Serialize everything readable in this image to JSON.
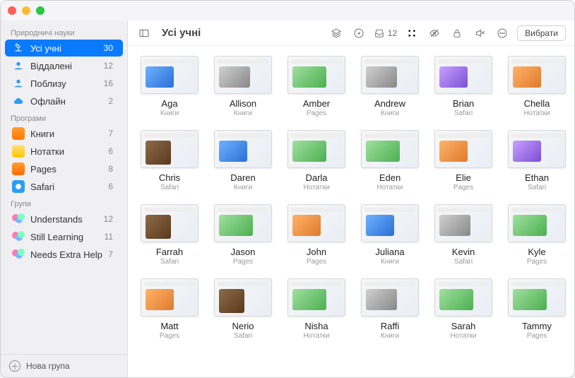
{
  "window": {
    "title": "Усі учні"
  },
  "toolbar": {
    "inbox_count": "12",
    "select_label": "Вибрати"
  },
  "sidebar": {
    "sections": [
      {
        "title": "Природничі науки",
        "items": [
          {
            "label": "Усі учні",
            "count": "30",
            "icon": "microscope",
            "active": true
          },
          {
            "label": "Віддалені",
            "count": "12",
            "icon": "person-blue"
          },
          {
            "label": "Поблизу",
            "count": "16",
            "icon": "person-blue"
          },
          {
            "label": "Офлайн",
            "count": "2",
            "icon": "cloud"
          }
        ]
      },
      {
        "title": "Програми",
        "items": [
          {
            "label": "Книги",
            "count": "7",
            "icon": "books"
          },
          {
            "label": "Нотатки",
            "count": "6",
            "icon": "notes"
          },
          {
            "label": "Pages",
            "count": "8",
            "icon": "pages"
          },
          {
            "label": "Safari",
            "count": "6",
            "icon": "safari"
          }
        ]
      },
      {
        "title": "Групи",
        "items": [
          {
            "label": "Understands",
            "count": "12",
            "icon": "group"
          },
          {
            "label": "Still Learning",
            "count": "11",
            "icon": "group"
          },
          {
            "label": "Needs Extra Help",
            "count": "7",
            "icon": "group"
          }
        ]
      }
    ],
    "footer": {
      "new_group": "Нова група"
    }
  },
  "students": [
    {
      "name": "Aga",
      "app": "Книги",
      "v": 1
    },
    {
      "name": "Allison",
      "app": "Книги",
      "v": 4
    },
    {
      "name": "Amber",
      "app": "Pages",
      "v": 3
    },
    {
      "name": "Andrew",
      "app": "Книги",
      "v": 4
    },
    {
      "name": "Brian",
      "app": "Safari",
      "v": 5
    },
    {
      "name": "Chella",
      "app": "Нотатки",
      "v": 2
    },
    {
      "name": "Chris",
      "app": "Safari",
      "v": 6
    },
    {
      "name": "Daren",
      "app": "Книги",
      "v": 1
    },
    {
      "name": "Darla",
      "app": "Нотатки",
      "v": 3
    },
    {
      "name": "Eden",
      "app": "Нотатки",
      "v": 3
    },
    {
      "name": "Elie",
      "app": "Pages",
      "v": 2
    },
    {
      "name": "Ethan",
      "app": "Safari",
      "v": 5
    },
    {
      "name": "Farrah",
      "app": "Safari",
      "v": 6
    },
    {
      "name": "Jason",
      "app": "Pages",
      "v": 3
    },
    {
      "name": "John",
      "app": "Pages",
      "v": 2
    },
    {
      "name": "Juliana",
      "app": "Книги",
      "v": 1
    },
    {
      "name": "Kevin",
      "app": "Safari",
      "v": 4
    },
    {
      "name": "Kyle",
      "app": "Pages",
      "v": 3
    },
    {
      "name": "Matt",
      "app": "Pages",
      "v": 2
    },
    {
      "name": "Nerio",
      "app": "Safari",
      "v": 6
    },
    {
      "name": "Nisha",
      "app": "Нотатки",
      "v": 3
    },
    {
      "name": "Raffi",
      "app": "Книги",
      "v": 4
    },
    {
      "name": "Sarah",
      "app": "Нотатки",
      "v": 3
    },
    {
      "name": "Tammy",
      "app": "Pages",
      "v": 3
    }
  ]
}
